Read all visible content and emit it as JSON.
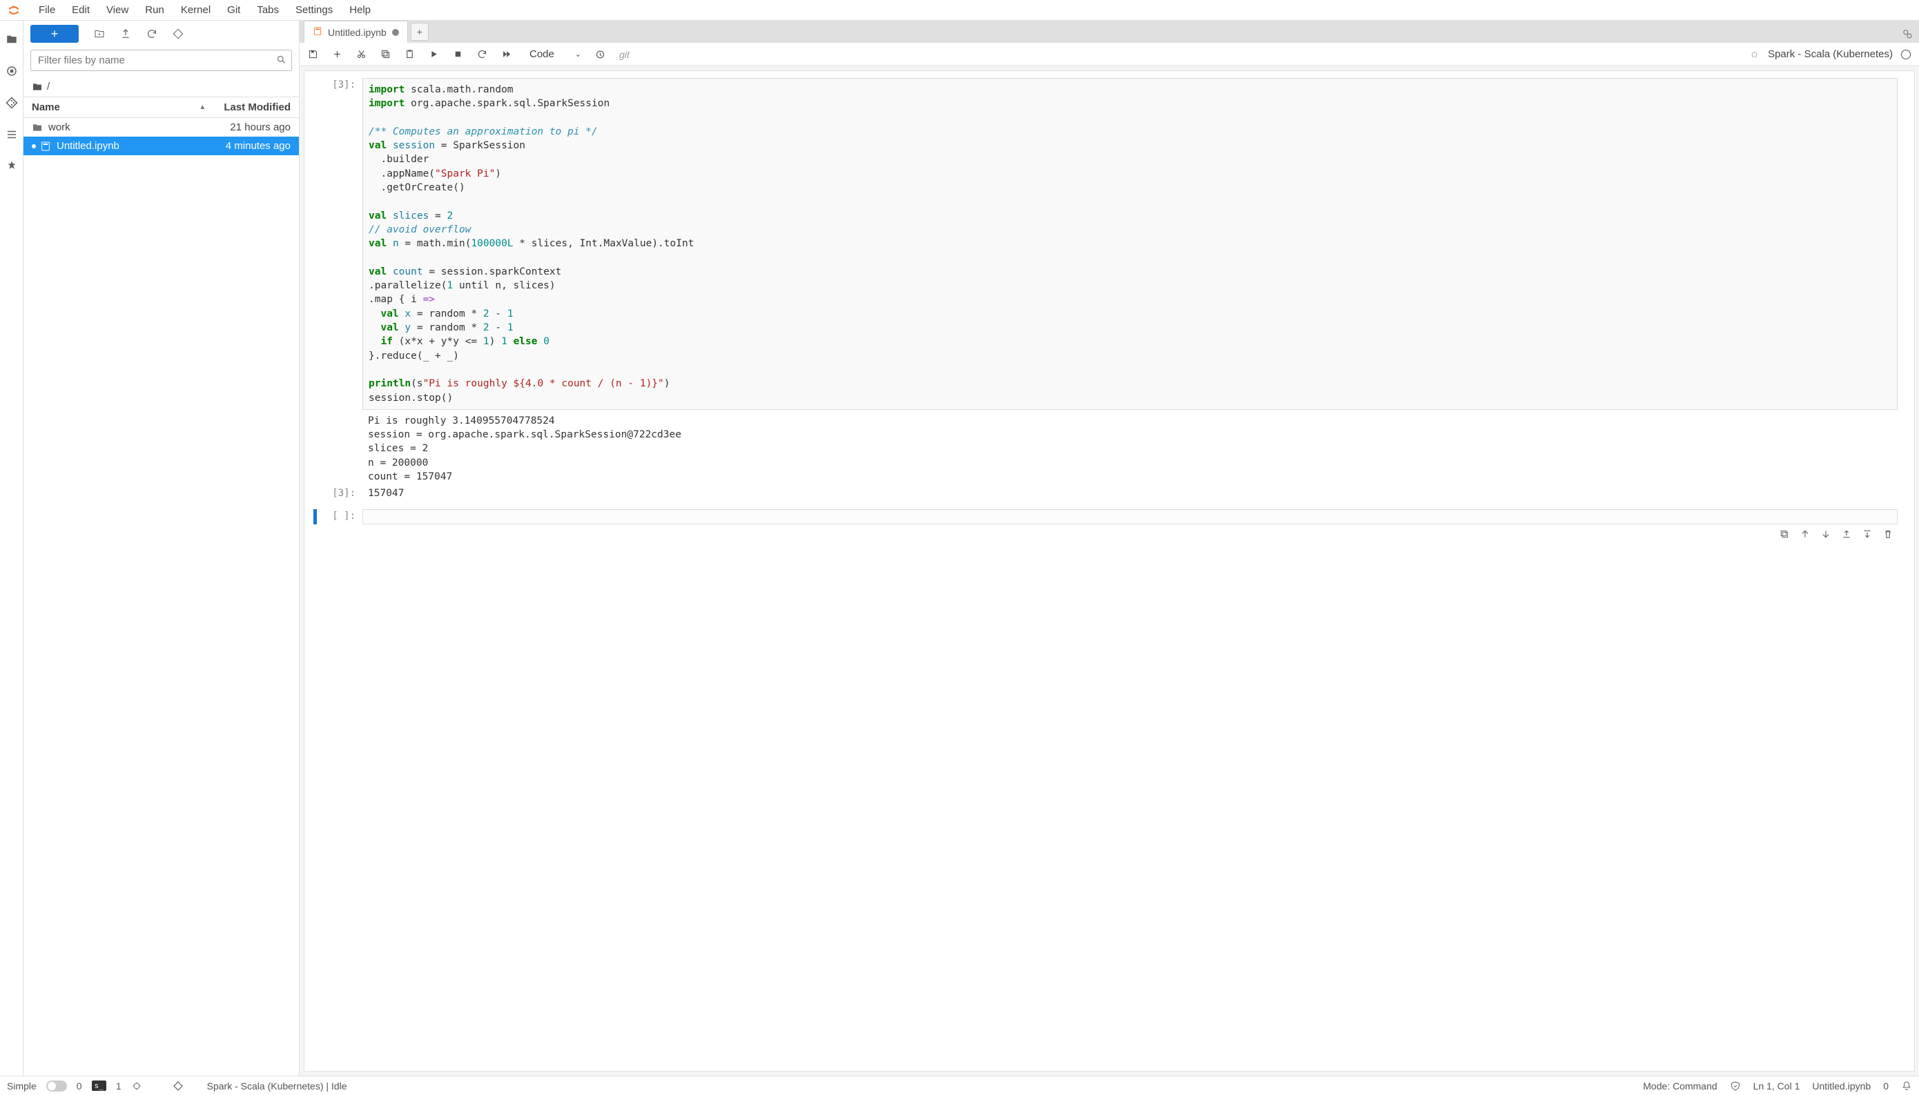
{
  "menubar": {
    "items": [
      "File",
      "Edit",
      "View",
      "Run",
      "Kernel",
      "Git",
      "Tabs",
      "Settings",
      "Help"
    ]
  },
  "filepanel": {
    "filter_placeholder": "Filter files by name",
    "breadcrumb_root": "/",
    "header_name": "Name",
    "header_modified": "Last Modified",
    "rows": [
      {
        "icon": "folder",
        "name": "work",
        "modified": "21 hours ago",
        "selected": false,
        "dirty": false
      },
      {
        "icon": "notebook",
        "name": "Untitled.ipynb",
        "modified": "4 minutes ago",
        "selected": true,
        "dirty": true
      }
    ]
  },
  "tabs": {
    "open": [
      {
        "name": "Untitled.ipynb",
        "dirty": true
      }
    ]
  },
  "nb_toolbar": {
    "celltype": "Code",
    "git_label": "git",
    "kernel_name": "Spark - Scala (Kubernetes)"
  },
  "cells": {
    "exec_prompt_1": "[3]:",
    "output_prompt": "[3]:",
    "empty_prompt": "[ ]:",
    "output_text": "Pi is roughly 3.140955704778524\nsession = org.apache.spark.sql.SparkSession@722cd3ee\nslices = 2\nn = 200000\ncount = 157047",
    "result_text": "157047",
    "code": {
      "l1a": "import",
      "l1b": " scala.math.random",
      "l2a": "import",
      "l2b": " org.apache.spark.sql.SparkSession",
      "c1": "/** Computes an approximation to pi */",
      "l3a": "val",
      "l3b": "session",
      "l3c": " = SparkSession",
      "l4": "  .builder",
      "l5a": "  .appName(",
      "l5b": "\"Spark Pi\"",
      "l5c": ")",
      "l6": "  .getOrCreate()",
      "l7a": "val",
      "l7b": "slices",
      "l7c": " = ",
      "l7d": "2",
      "c2": "// avoid overflow",
      "l8a": "val",
      "l8b": "n",
      "l8c": " = math.min(",
      "l8d": "100000L",
      "l8e": " * slices, Int.MaxValue).toInt",
      "l9a": "val",
      "l9b": "count",
      "l9c": " = session.sparkContext",
      "l10a": ".parallelize(",
      "l10b": "1",
      "l10c": " until n, slices)",
      "l11a": ".map { i ",
      "l11b": "=>",
      "l12a": "  ",
      "l12b": "val",
      "l12c": "x",
      "l12d": " = random * ",
      "l12e": "2",
      "l12f": " - ",
      "l12g": "1",
      "l13a": "  ",
      "l13b": "val",
      "l13c": "y",
      "l13d": " = random * ",
      "l13e": "2",
      "l13f": " - ",
      "l13g": "1",
      "l14a": "  ",
      "l14b": "if",
      "l14c": " (x*x + y*y <= ",
      "l14d": "1",
      "l14e": ") ",
      "l14f": "1",
      "l14g": " ",
      "l14h": "else",
      "l14i": " ",
      "l14j": "0",
      "l15": "}.reduce(_ + _)",
      "l16a": "println",
      "l16b": "(s",
      "l16c": "\"Pi is roughly ${4.0 * count / (n - 1)}\"",
      "l16d": ")",
      "l17": "session.stop()"
    }
  },
  "statusbar": {
    "simple": "Simple",
    "zero": "0",
    "terminals_count": "1",
    "kernel_status": "Spark - Scala (Kubernetes) | Idle",
    "mode": "Mode: Command",
    "cursor": "Ln 1, Col 1",
    "filename": "Untitled.ipynb",
    "right_zero": "0"
  }
}
